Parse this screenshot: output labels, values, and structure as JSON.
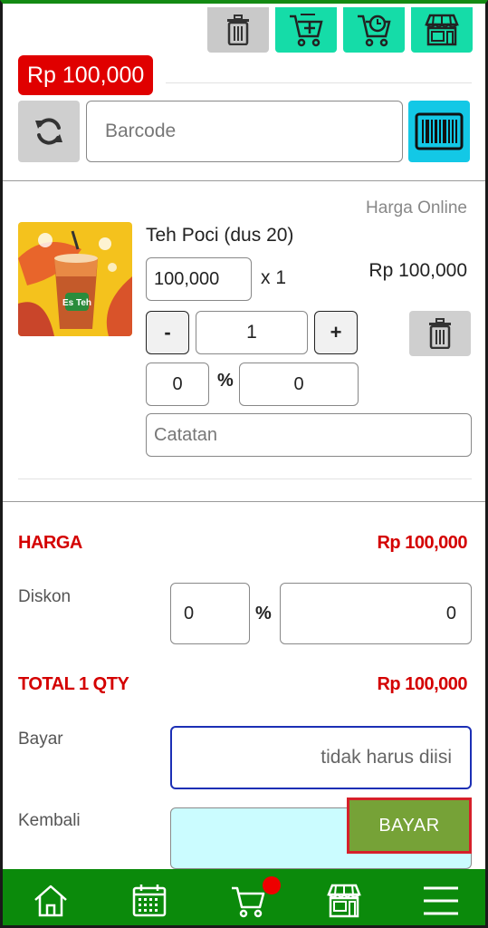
{
  "toolbar": {
    "icons": [
      "trash-icon",
      "cart-add-icon",
      "cart-clock-icon",
      "store-icon"
    ]
  },
  "header": {
    "total_badge": "Rp 100,000",
    "barcode_placeholder": "Barcode"
  },
  "item": {
    "price_type": "Harga Online",
    "name": "Teh Poci (dus 20)",
    "unit_price": "100,000",
    "multiplier": "x 1",
    "line_total": "Rp 100,000",
    "minus_label": "-",
    "plus_label": "+",
    "quantity": "1",
    "discount_percent": "0",
    "percent_symbol": "%",
    "discount_amount": "0",
    "note_placeholder": "Catatan",
    "image_text": "Es Teh"
  },
  "summary": {
    "harga_label": "HARGA",
    "harga_value": "Rp 100,000",
    "diskon_label": "Diskon",
    "diskon_percent": "0",
    "percent_symbol": "%",
    "diskon_amount": "0",
    "total_label": "TOTAL 1 QTY",
    "total_value": "Rp 100,000",
    "bayar_label": "Bayar",
    "bayar_placeholder": "tidak harus diisi",
    "kembali_label": "Kembali",
    "pay_button": "BAYAR"
  },
  "nav": {
    "items": [
      "home-icon",
      "calendar-icon",
      "cart-icon",
      "store-icon",
      "menu-icon"
    ],
    "cart_badge_color": "#ee0000"
  },
  "colors": {
    "accent_green": "#15dca8",
    "nav_green": "#0b8a0b",
    "price_red": "#d40000",
    "scan_cyan": "#13c8e6",
    "pay_green": "#76a237"
  }
}
